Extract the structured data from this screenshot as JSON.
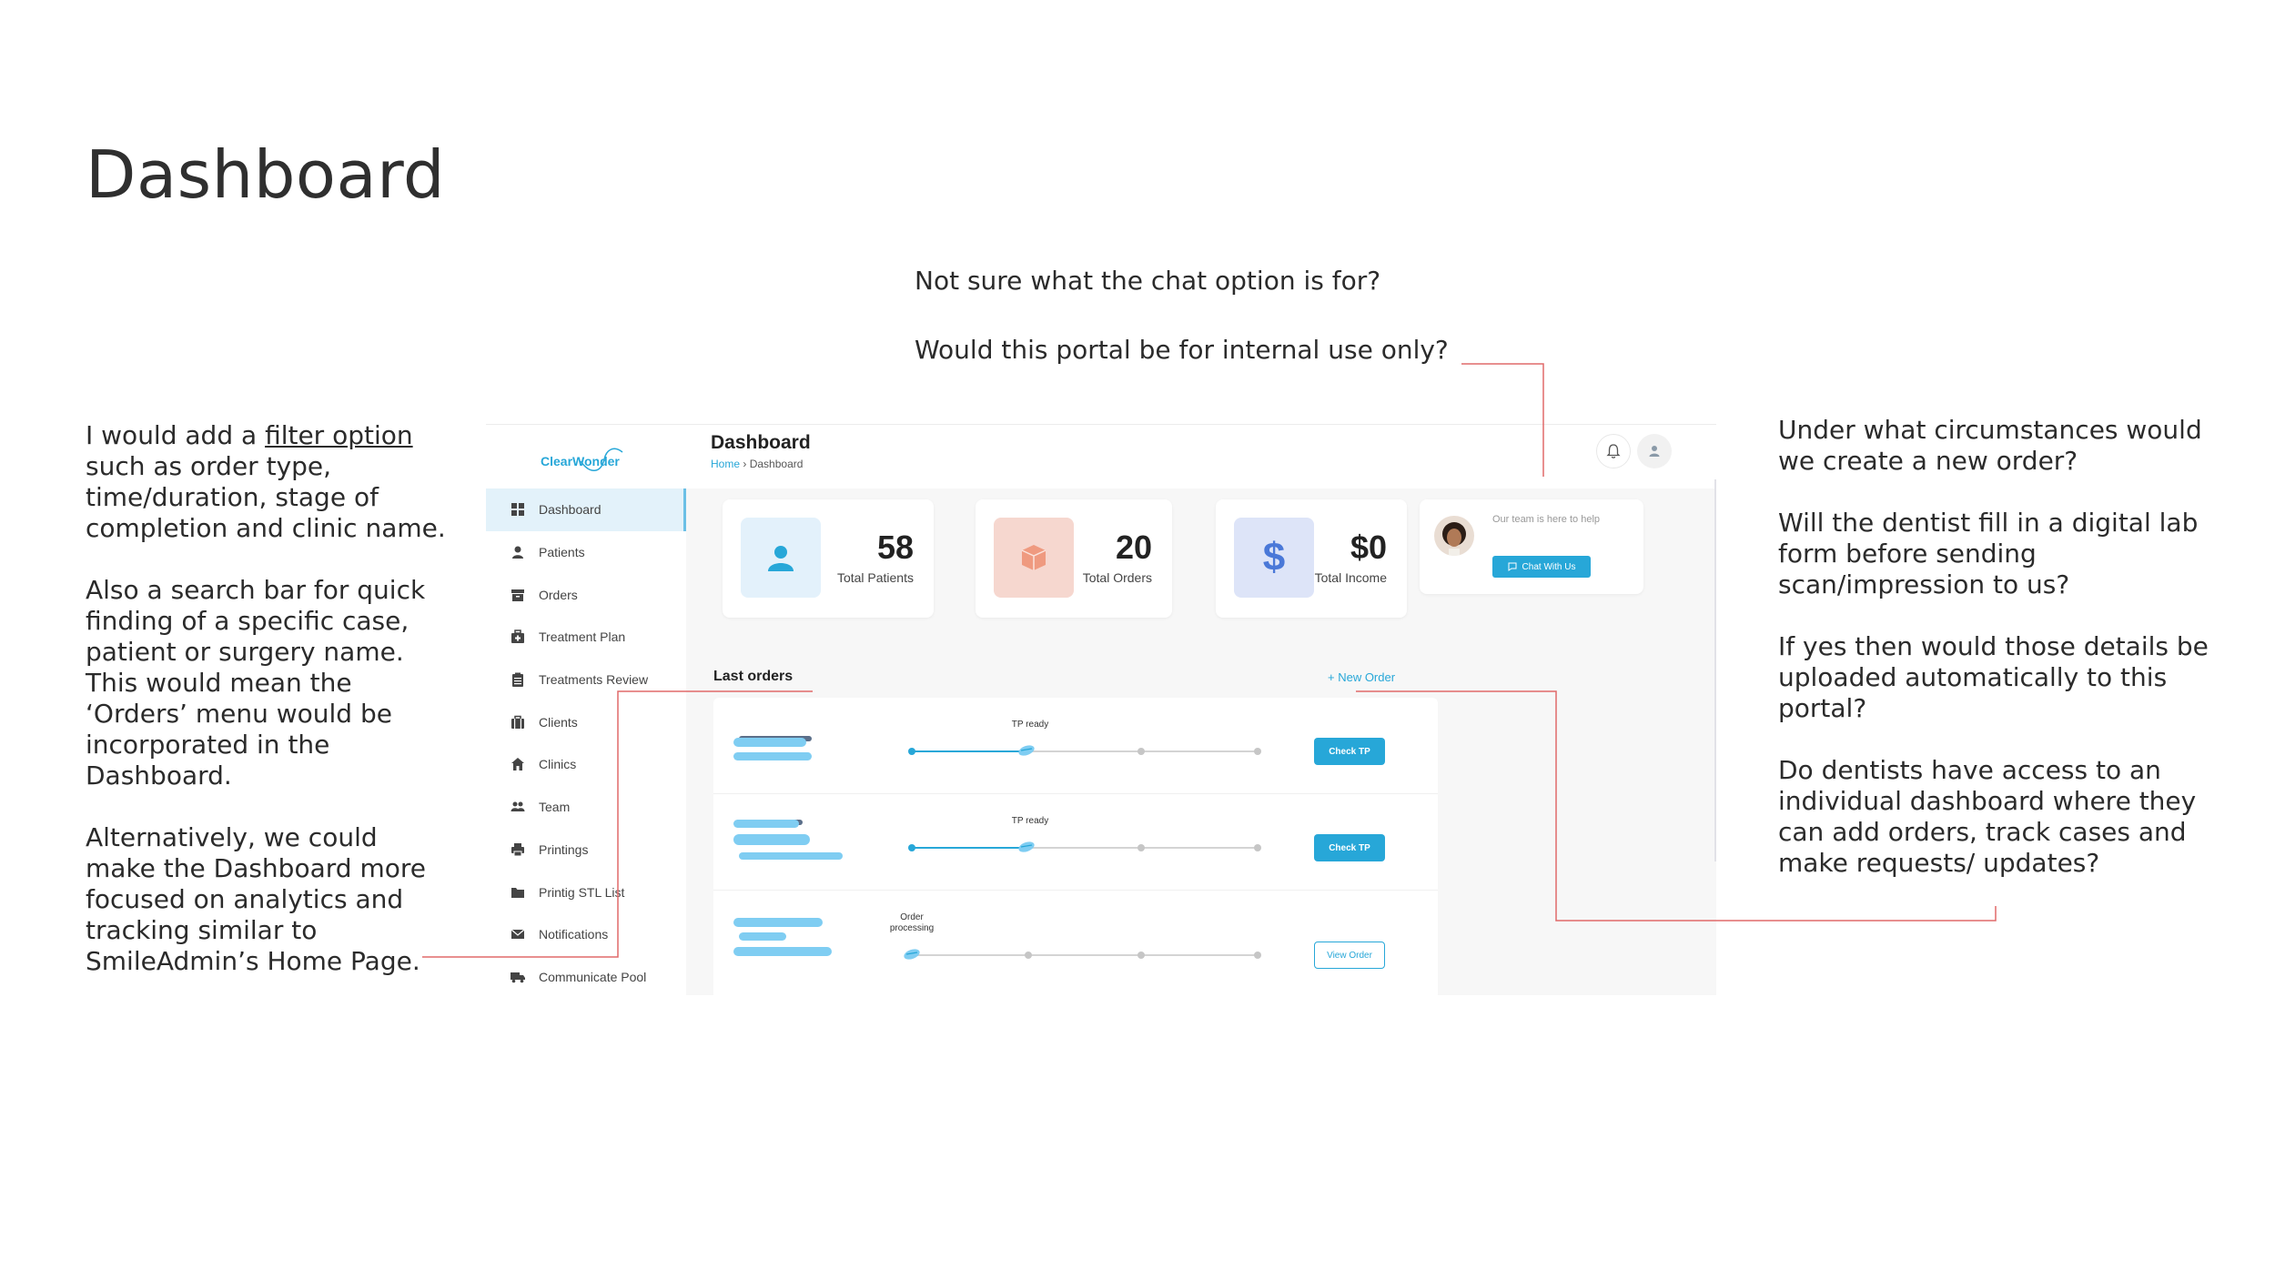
{
  "slide": {
    "title": "Dashboard"
  },
  "notes": {
    "left": {
      "p1_prefix": "I would add a ",
      "p1_link": "filter option",
      "p1_suffix": " such as order type, time/duration, stage of completion and clinic name.",
      "p2": "Also a search bar for quick finding of a specific case, patient or surgery name. This would mean the ‘Orders’ menu would be incorporated in the Dashboard.",
      "p3": "Alternatively, we could make the Dashboard more focused on analytics and tracking similar to SmileAdmin’s Home Page."
    },
    "top": {
      "p1": "Not sure what the chat option is for?",
      "p2": "Would this portal be for internal use only?"
    },
    "right": {
      "p1": "Under what circumstances would we create a new order?",
      "p2": "Will the dentist fill in a digital lab form before sending scan/impression to us?",
      "p3": "If yes then would those details be uploaded automatically to this portal?",
      "p4": "Do dentists have access to an individual dashboard where they can add orders,  track cases and make requests/ updates?"
    }
  },
  "app": {
    "brand": "ClearWonder",
    "sidebar": {
      "items": [
        {
          "label": "Dashboard",
          "icon": "grid-icon"
        },
        {
          "label": "Patients",
          "icon": "person-icon"
        },
        {
          "label": "Orders",
          "icon": "archive-icon"
        },
        {
          "label": "Treatment Plan",
          "icon": "medical-case-icon"
        },
        {
          "label": "Treatments Review",
          "icon": "clipboard-icon"
        },
        {
          "label": "Clients",
          "icon": "briefcase-icon"
        },
        {
          "label": "Clinics",
          "icon": "home-icon"
        },
        {
          "label": "Team",
          "icon": "team-icon"
        },
        {
          "label": "Printings",
          "icon": "printer-icon"
        },
        {
          "label": "Printig STL List",
          "icon": "folder-icon"
        },
        {
          "label": "Notifications",
          "icon": "mail-icon"
        },
        {
          "label": "Communicate Pool",
          "icon": "truck-icon"
        }
      ]
    },
    "header": {
      "title": "Dashboard",
      "breadcrumb_home": "Home",
      "breadcrumb_sep": "›",
      "breadcrumb_current": "Dashboard"
    },
    "stats": [
      {
        "value": "58",
        "label": "Total Patients",
        "icon": "person-icon",
        "bg": "#e3f1fb"
      },
      {
        "value": "20",
        "label": "Total Orders",
        "icon": "box-icon",
        "bg": "#f6d7cf"
      },
      {
        "value": "$0",
        "label": "Total Income",
        "icon": "dollar-icon",
        "bg": "#dde4f8"
      }
    ],
    "chat": {
      "text": "Our team is here to help",
      "button": "Chat With Us"
    },
    "orders": {
      "title": "Last orders",
      "new_order": "+ New Order",
      "rows": [
        {
          "stage": "TP ready",
          "button": "Check TP",
          "progress": 0.33
        },
        {
          "stage": "TP ready",
          "button": "Check TP",
          "progress": 0.33
        },
        {
          "stage": "Order processing",
          "button": "View Order",
          "progress": 0.0
        }
      ]
    },
    "colors": {
      "accent": "#27a7d8",
      "annotation_line": "#e06a6a"
    }
  }
}
